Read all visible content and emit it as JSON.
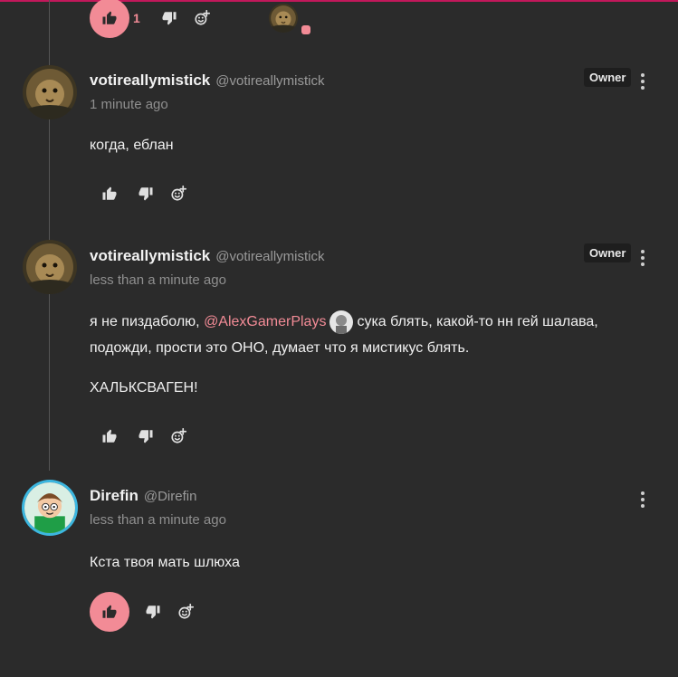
{
  "top_reply_bar": {
    "like_count": "1"
  },
  "comments": [
    {
      "username": "votireallymistick",
      "handle": "@votireallymistick",
      "time": "1 minute ago",
      "badge": "Owner",
      "text": "когда, еблан"
    },
    {
      "username": "votireallymistick",
      "handle": "@votireallymistick",
      "time": "less than a minute ago",
      "badge": "Owner",
      "text_before": "я не пиздаболю,",
      "mention": "@AlexGamerPlays",
      "text_after": "сука блять, какой-то нн гей шалава, подожди, прости это ОНО, думает что я мистикус блять.",
      "text2": "ХАЛЬКСВАГЕН!"
    },
    {
      "username": "Direfin",
      "handle": "@Direfin",
      "time": "less than a minute ago",
      "text": "Кста твоя мать шлюха"
    }
  ],
  "colors": {
    "accent": "#f28b96",
    "background": "#2b2b2b",
    "topline": "#c2185b"
  },
  "icons": [
    "thumbs-up-icon",
    "thumbs-down-icon",
    "add-reaction-icon",
    "more-vertical-icon"
  ]
}
